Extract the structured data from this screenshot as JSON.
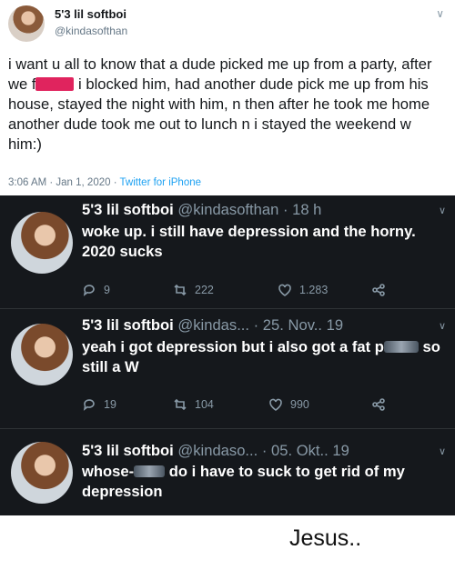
{
  "top_tweet": {
    "display_name": "5'3 lil softboi",
    "handle": "@kindasofthan",
    "text_before_redaction": "i want u all to know that a dude picked me up from a party, after we f",
    "text_after_redaction": " i blocked him, had another dude pick me up from his house, stayed the night with him, n then after he took me home another dude took me out to lunch n i stayed the weekend w him:)",
    "timestamp": "3:06 AM · Jan 1, 2020 · ",
    "source": "Twitter for iPhone"
  },
  "dark_tweets": [
    {
      "display_name": "5'3 lil softboi",
      "handle": "@kindasofthan",
      "time": "· 18 h",
      "text": "woke up. i still have depression and the horny. 2020 sucks",
      "replies": "9",
      "retweets": "222",
      "likes": "1.283"
    },
    {
      "display_name": "5'3 lil softboi",
      "handle": "@kindas...",
      "time": "· 25. Nov.. 19",
      "text_before_redaction": "yeah i got depression but i also got a fat ",
      "redaction_prefix": "p",
      "text_after_redaction": "so still a W",
      "replies": "19",
      "retweets": "104",
      "likes": "990"
    },
    {
      "display_name": "5'3 lil softboi",
      "handle": "@kindaso...",
      "time": "· 05. Okt.. 19",
      "text_before_redaction": "whose-",
      "text_after_redaction": "do i have to suck to get rid of my depression"
    }
  ],
  "caption": "Jesus..",
  "colors": {
    "dark_bg": "#15181c",
    "accent": "#1da1f2",
    "redaction": "#e0245e"
  }
}
